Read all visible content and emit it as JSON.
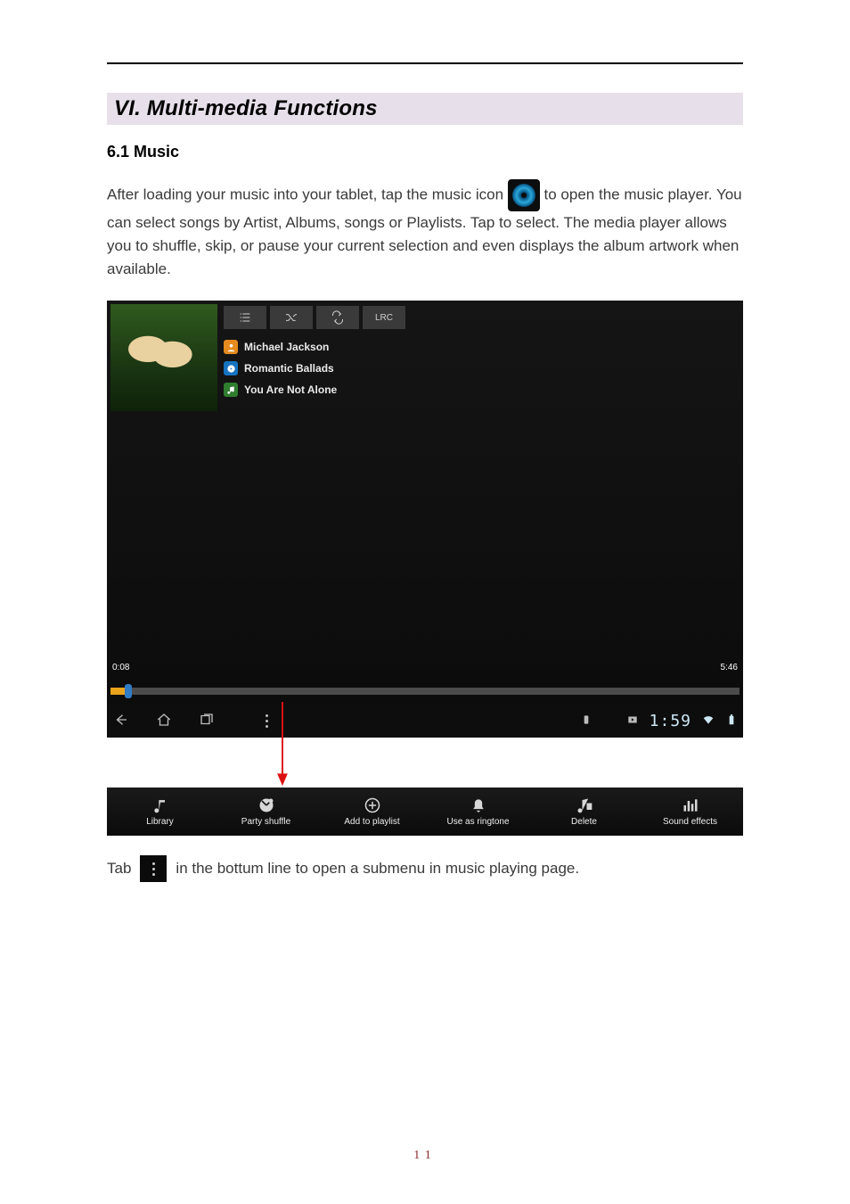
{
  "section_heading": "VI. Multi-media Functions",
  "sub_heading": "6.1 Music",
  "para_pre": "After loading your music into your tablet, tap the music icon",
  "para_post": "to open the music player. You can select songs by Artist, Albums, songs or Playlists. Tap to select. The media player allows you to shuffle, skip, or pause your current selection and even displays the album artwork when available.",
  "player": {
    "lrc_tab": "LRC",
    "artist": "Michael Jackson",
    "album": "Romantic Ballads",
    "song": "You Are Not Alone",
    "elapsed": "0:08",
    "total": "5:46",
    "clock": "1:59"
  },
  "submenu": {
    "library": "Library",
    "party_shuffle": "Party shuffle",
    "add_to_playlist": "Add to playlist",
    "use_as_ringtone": "Use as ringtone",
    "delete": "Delete",
    "sound_effects": "Sound effects"
  },
  "para2_pre": "Tab",
  "para2_post": "in the bottum line to open a submenu in music playing page.",
  "page_number": "11"
}
